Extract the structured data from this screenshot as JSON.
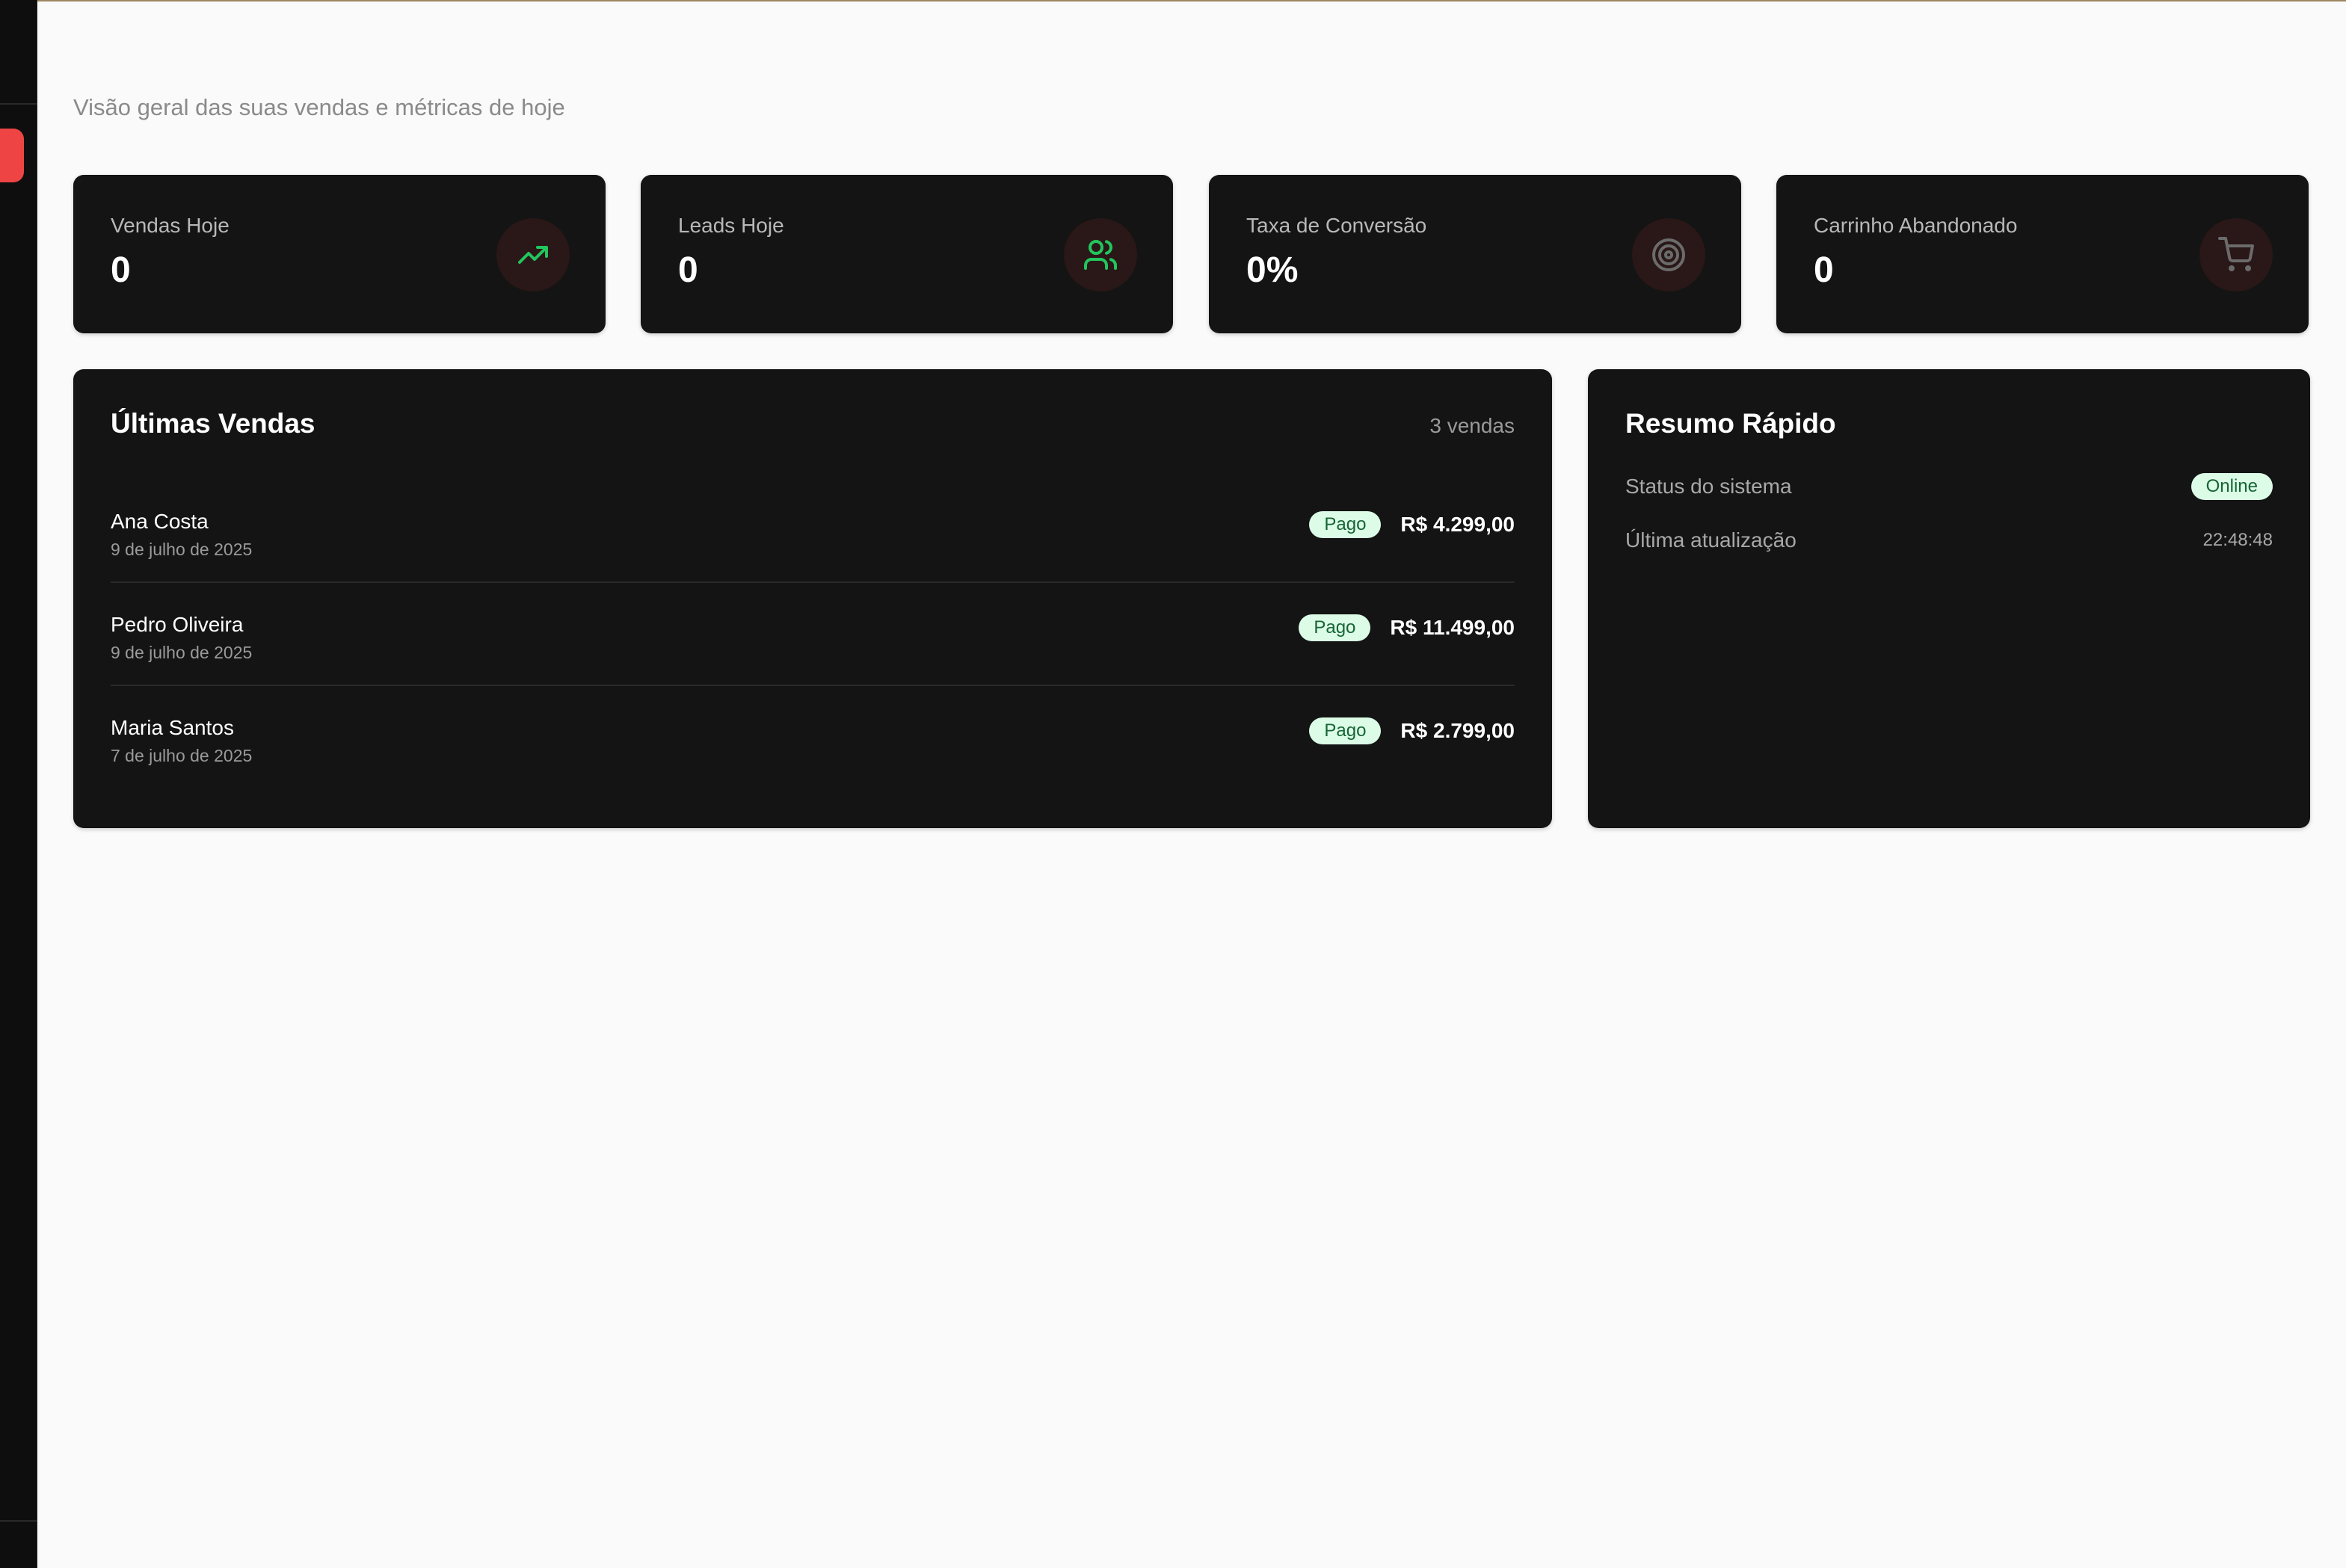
{
  "header": {
    "subtitle": "Visão geral das suas vendas e métricas de hoje"
  },
  "stats": [
    {
      "label": "Vendas Hoje",
      "value": "0",
      "icon": "trending-up-icon",
      "color": "#22c55e"
    },
    {
      "label": "Leads Hoje",
      "value": "0",
      "icon": "users-icon",
      "color": "#22c55e"
    },
    {
      "label": "Taxa de Conversão",
      "value": "0%",
      "icon": "target-icon",
      "color": "#6b6b6b"
    },
    {
      "label": "Carrinho Abandonado",
      "value": "0",
      "icon": "cart-icon",
      "color": "#6b6b6b"
    }
  ],
  "recent_sales": {
    "title": "Últimas Vendas",
    "count": "3 vendas",
    "rows": [
      {
        "name": "Ana Costa",
        "date": "9 de julho de 2025",
        "status": "Pago",
        "amount": "R$ 4.299,00"
      },
      {
        "name": "Pedro Oliveira",
        "date": "9 de julho de 2025",
        "status": "Pago",
        "amount": "R$ 11.499,00"
      },
      {
        "name": "Maria Santos",
        "date": "7 de julho de 2025",
        "status": "Pago",
        "amount": "R$ 2.799,00"
      }
    ]
  },
  "summary": {
    "title": "Resumo Rápido",
    "status_label": "Status do sistema",
    "status_value": "Online",
    "updated_label": "Última atualização",
    "updated_value": "22:48:48"
  },
  "colors": {
    "accent": "#ef4444",
    "card_bg": "#141414",
    "badge_bg": "#dcfce7",
    "badge_text": "#166534",
    "icon_bg": "#2a1717"
  }
}
